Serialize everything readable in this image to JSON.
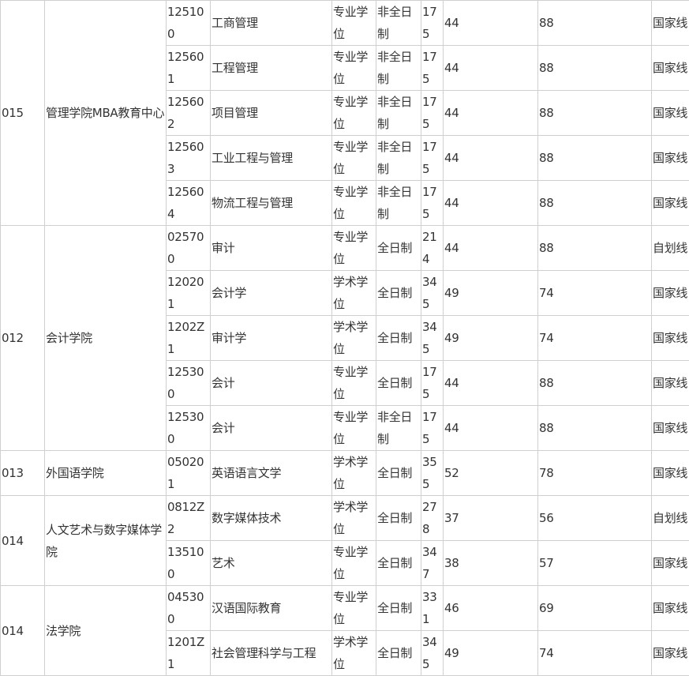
{
  "groups": [
    {
      "code": "015",
      "college": "管理学院MBA教育中心",
      "rows": [
        {
          "major_code": "125100",
          "major_name": "工商管理",
          "degree_type": "专业学位",
          "study_mode": "非全日制",
          "total_score": "175",
          "score_a": "44",
          "score_b": "88",
          "line_type": "国家线"
        },
        {
          "major_code": "125601",
          "major_name": "工程管理",
          "degree_type": "专业学位",
          "study_mode": "非全日制",
          "total_score": "175",
          "score_a": "44",
          "score_b": "88",
          "line_type": "国家线"
        },
        {
          "major_code": "125602",
          "major_name": "项目管理",
          "degree_type": "专业学位",
          "study_mode": "非全日制",
          "total_score": "175",
          "score_a": "44",
          "score_b": "88",
          "line_type": "国家线"
        },
        {
          "major_code": "125603",
          "major_name": "工业工程与管理",
          "degree_type": "专业学位",
          "study_mode": "非全日制",
          "total_score": "175",
          "score_a": "44",
          "score_b": "88",
          "line_type": "国家线"
        },
        {
          "major_code": "125604",
          "major_name": "物流工程与管理",
          "degree_type": "专业学位",
          "study_mode": "非全日制",
          "total_score": "175",
          "score_a": "44",
          "score_b": "88",
          "line_type": "国家线"
        }
      ]
    },
    {
      "code": "012",
      "college": "会计学院",
      "rows": [
        {
          "major_code": "025700",
          "major_name": "审计",
          "degree_type": "专业学位",
          "study_mode": "全日制",
          "total_score": "214",
          "score_a": "44",
          "score_b": "88",
          "line_type": "自划线"
        },
        {
          "major_code": "120201",
          "major_name": "会计学",
          "degree_type": "学术学位",
          "study_mode": "全日制",
          "total_score": "345",
          "score_a": "49",
          "score_b": "74",
          "line_type": "国家线"
        },
        {
          "major_code": "1202Z1",
          "major_name": "审计学",
          "degree_type": "学术学位",
          "study_mode": "全日制",
          "total_score": "345",
          "score_a": "49",
          "score_b": "74",
          "line_type": "国家线"
        },
        {
          "major_code": "125300",
          "major_name": "会计",
          "degree_type": "专业学位",
          "study_mode": "全日制",
          "total_score": "175",
          "score_a": "44",
          "score_b": "88",
          "line_type": "国家线"
        },
        {
          "major_code": "125300",
          "major_name": "会计",
          "degree_type": "专业学位",
          "study_mode": "非全日制",
          "total_score": "175",
          "score_a": "44",
          "score_b": "88",
          "line_type": "国家线"
        }
      ]
    },
    {
      "code": "013",
      "college": "外国语学院",
      "rows": [
        {
          "major_code": "050201",
          "major_name": "英语语言文学",
          "degree_type": "学术学位",
          "study_mode": "全日制",
          "total_score": "355",
          "score_a": "52",
          "score_b": "78",
          "line_type": "国家线"
        }
      ]
    },
    {
      "code": "014",
      "college": "人文艺术与数字媒体学院",
      "rows": [
        {
          "major_code": "0812Z2",
          "major_name": "数字媒体技术",
          "degree_type": "学术学位",
          "study_mode": "全日制",
          "total_score": "278",
          "score_a": "37",
          "score_b": "56",
          "line_type": "自划线"
        },
        {
          "major_code": "135100",
          "major_name": "艺术",
          "degree_type": "专业学位",
          "study_mode": "全日制",
          "total_score": "347",
          "score_a": "38",
          "score_b": "57",
          "line_type": "国家线"
        }
      ]
    },
    {
      "code": "014",
      "college": "法学院",
      "rows": [
        {
          "major_code": "045300",
          "major_name": "汉语国际教育",
          "degree_type": "专业学位",
          "study_mode": "全日制",
          "total_score": "331",
          "score_a": "46",
          "score_b": "69",
          "line_type": "国家线"
        },
        {
          "major_code": "1201Z1",
          "major_name": "社会管理科学与工程",
          "degree_type": "学术学位",
          "study_mode": "全日制",
          "total_score": "345",
          "score_a": "49",
          "score_b": "74",
          "line_type": "国家线"
        }
      ]
    }
  ]
}
